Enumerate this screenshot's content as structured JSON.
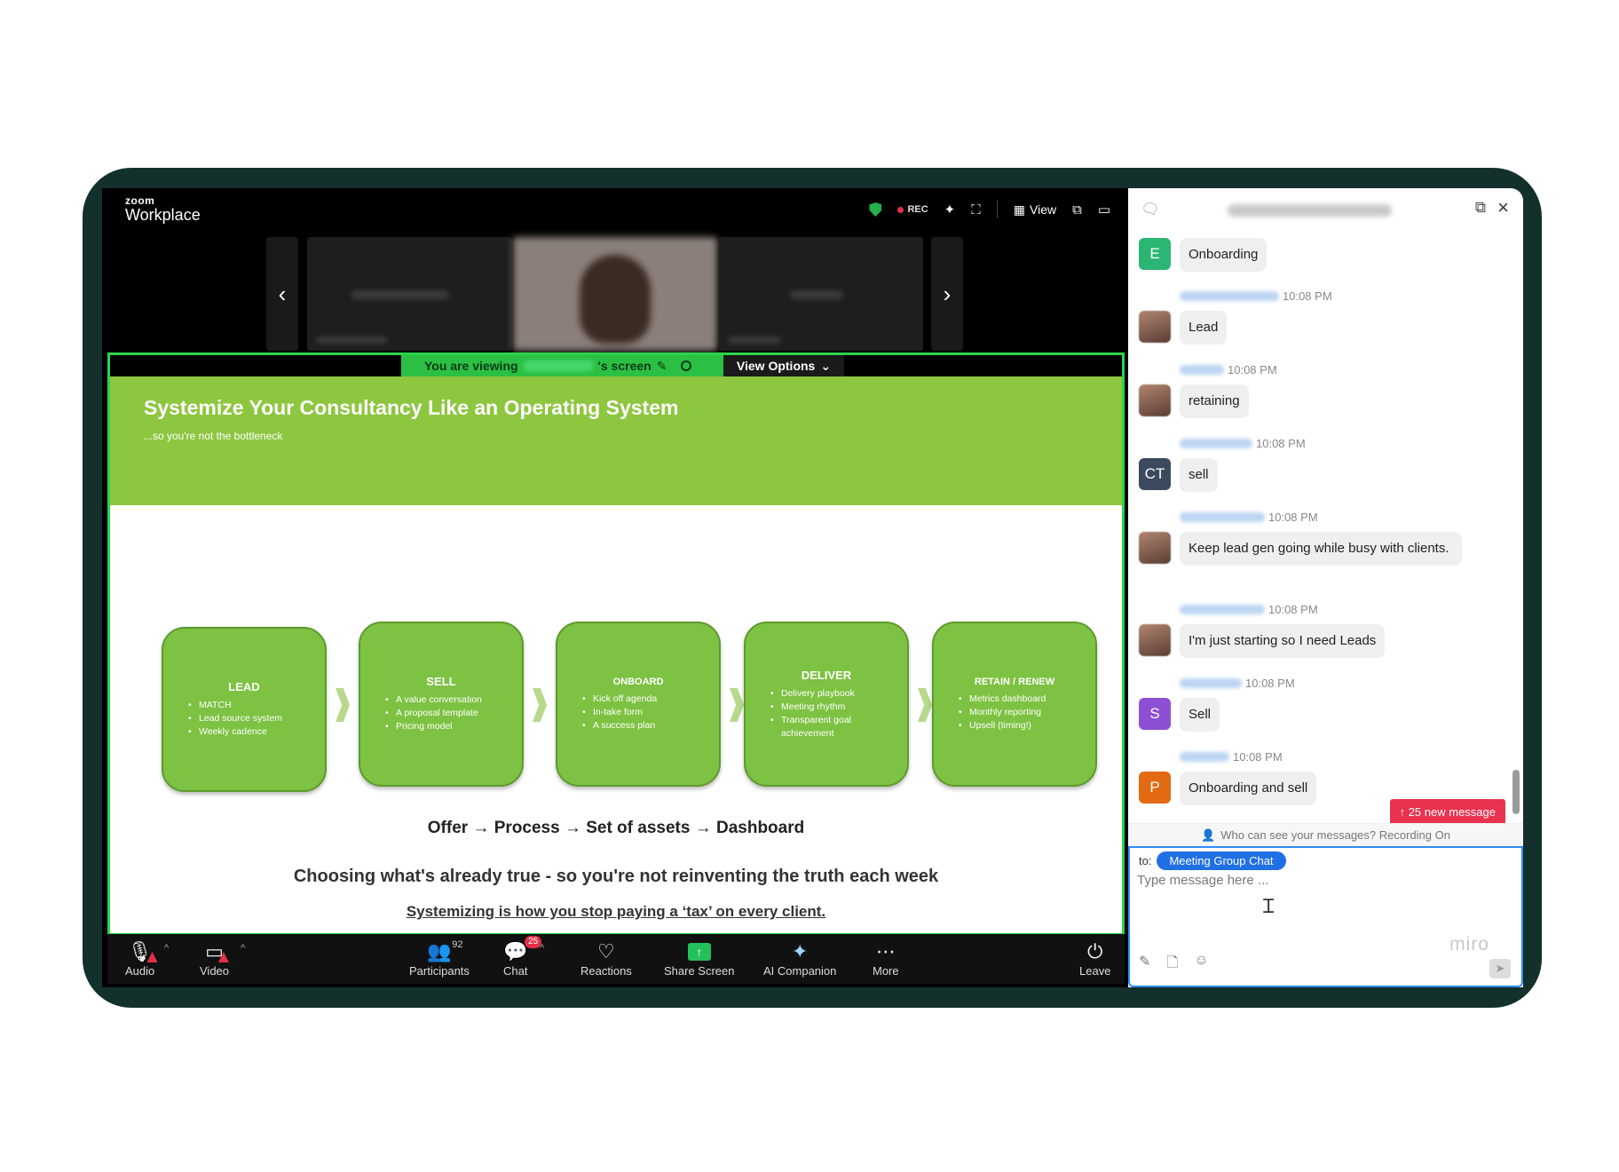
{
  "app": {
    "brand_small": "zoom",
    "brand_name": "Workplace"
  },
  "topbar": {
    "rec_label": "REC",
    "view_label": "View",
    "icons": [
      "shield-check-icon",
      "ai-sparkle-icon",
      "fullscreen-icon",
      "view-grid-icon",
      "gallery-icon",
      "pip-icon"
    ]
  },
  "share": {
    "viewing_prefix": "You are viewing",
    "viewing_suffix": "'s screen",
    "view_options_label": "View Options"
  },
  "slide": {
    "title": "Systemize Your Consultancy Like an Operating System",
    "subtitle": "...so you're not the bottleneck",
    "steps": [
      {
        "title": "LEAD",
        "bullets": [
          "MATCH",
          "Lead source system",
          "Weekly cadence"
        ]
      },
      {
        "title": "SELL",
        "bullets": [
          "A value conversation",
          "A proposal template",
          "Pricing model"
        ]
      },
      {
        "title": "ONBOARD",
        "bullets": [
          "Kick off agenda",
          "In-take form",
          "A success plan"
        ]
      },
      {
        "title": "DELIVER",
        "bullets": [
          "Delivery playbook",
          "Meeting rhythm",
          "Transparent goal achievement"
        ]
      },
      {
        "title": "RETAIN / RENEW",
        "bullets": [
          "Metrics dashboard",
          "Monthly reporting",
          "Upsell (timing!)"
        ]
      }
    ],
    "flow": "Offer → Process → Set of assets → Dashboard",
    "choosing": "Choosing what's already true - so you're not reinventing the truth each week",
    "tax": "Systemizing is how you stop paying a ‘tax’ on every client."
  },
  "toolbar": {
    "audio": "Audio",
    "video": "Video",
    "participants": "Participants",
    "participants_count": "92",
    "chat": "Chat",
    "chat_badge": "25",
    "reactions": "Reactions",
    "share_screen": "Share Screen",
    "ai_companion": "AI Companion",
    "more": "More",
    "leave": "Leave"
  },
  "chat": {
    "messages": [
      {
        "avatar": "E",
        "text": "Onboarding",
        "time": ""
      },
      {
        "avatar": "",
        "text": "Lead",
        "time": "10:08 PM"
      },
      {
        "avatar": "",
        "text": "retaining",
        "time": "10:08 PM"
      },
      {
        "avatar": "CT",
        "text": "sell",
        "time": "10:08 PM"
      },
      {
        "avatar": "",
        "text": "Keep lead gen going while busy with clients.",
        "time": "10:08 PM"
      },
      {
        "avatar": "",
        "text": "I'm just starting so I need Leads",
        "time": "10:08 PM"
      },
      {
        "avatar": "S",
        "text": "Sell",
        "time": "10:08 PM"
      },
      {
        "avatar": "P",
        "text": "Onboarding and sell",
        "time": "10:08 PM"
      }
    ],
    "avatar_colors": {
      "E": "#2bb673",
      "CT": "#3b4a5e",
      "S": "#8d4fd4",
      "P": "#e26a12"
    },
    "new_messages": "↑ 25 new message",
    "who_can_see": "Who can see your messages? Recording On",
    "to_label": "to:",
    "to_recipient": "Meeting Group Chat",
    "placeholder": "Type message here ...",
    "watermark": "miro"
  }
}
